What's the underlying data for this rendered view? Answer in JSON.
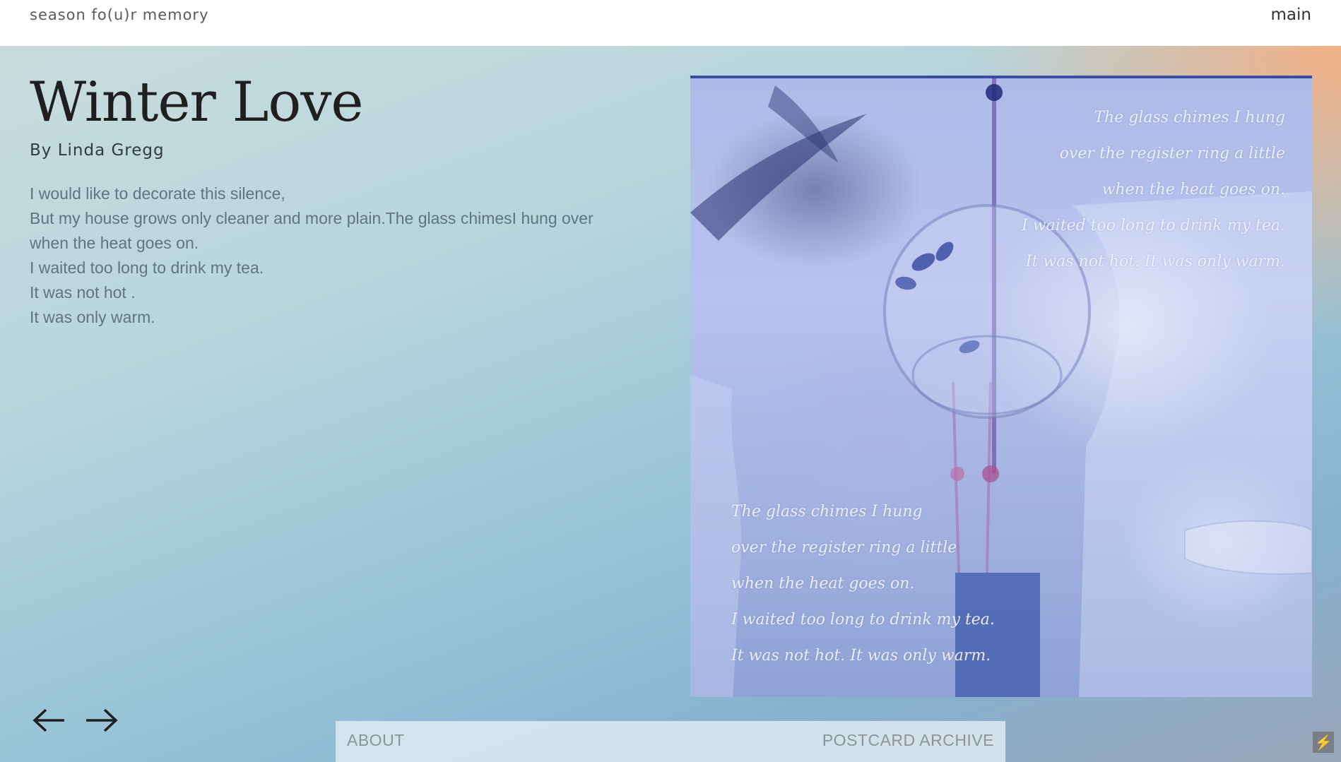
{
  "header": {
    "site_title": "season fo(u)r memory",
    "main_link": "main"
  },
  "poem": {
    "title": "Winter Love",
    "author": "By Linda Gregg",
    "lines": [
      "I would like to decorate this silence,",
      "But my house grows only cleaner and more plain.The glass chimesI hung over",
      "when the heat goes on.",
      "I waited too long to drink my tea.",
      "It was not hot .",
      "It was only warm."
    ]
  },
  "postcard": {
    "top_lines": [
      "The glass chimes I hung",
      "over the register ring a little",
      "when the heat goes on.",
      "I waited too long to drink my tea.",
      "It was not hot. It was only warm."
    ],
    "bottom_lines": [
      "The glass chimes I hung",
      "over the register ring a little",
      "when the heat goes on.",
      "I waited too long to drink my tea.",
      "It was not hot. It was only warm."
    ]
  },
  "nav": {
    "prev_icon": "arrow-left-icon",
    "next_icon": "arrow-right-icon"
  },
  "footer": {
    "about_label": "ABOUT",
    "archive_label": "POSTCARD ARCHIVE"
  },
  "colors": {
    "accent_peach": "#f7af80",
    "gradient_blue": "#86b2d0",
    "title_text": "#1f1f1f"
  }
}
